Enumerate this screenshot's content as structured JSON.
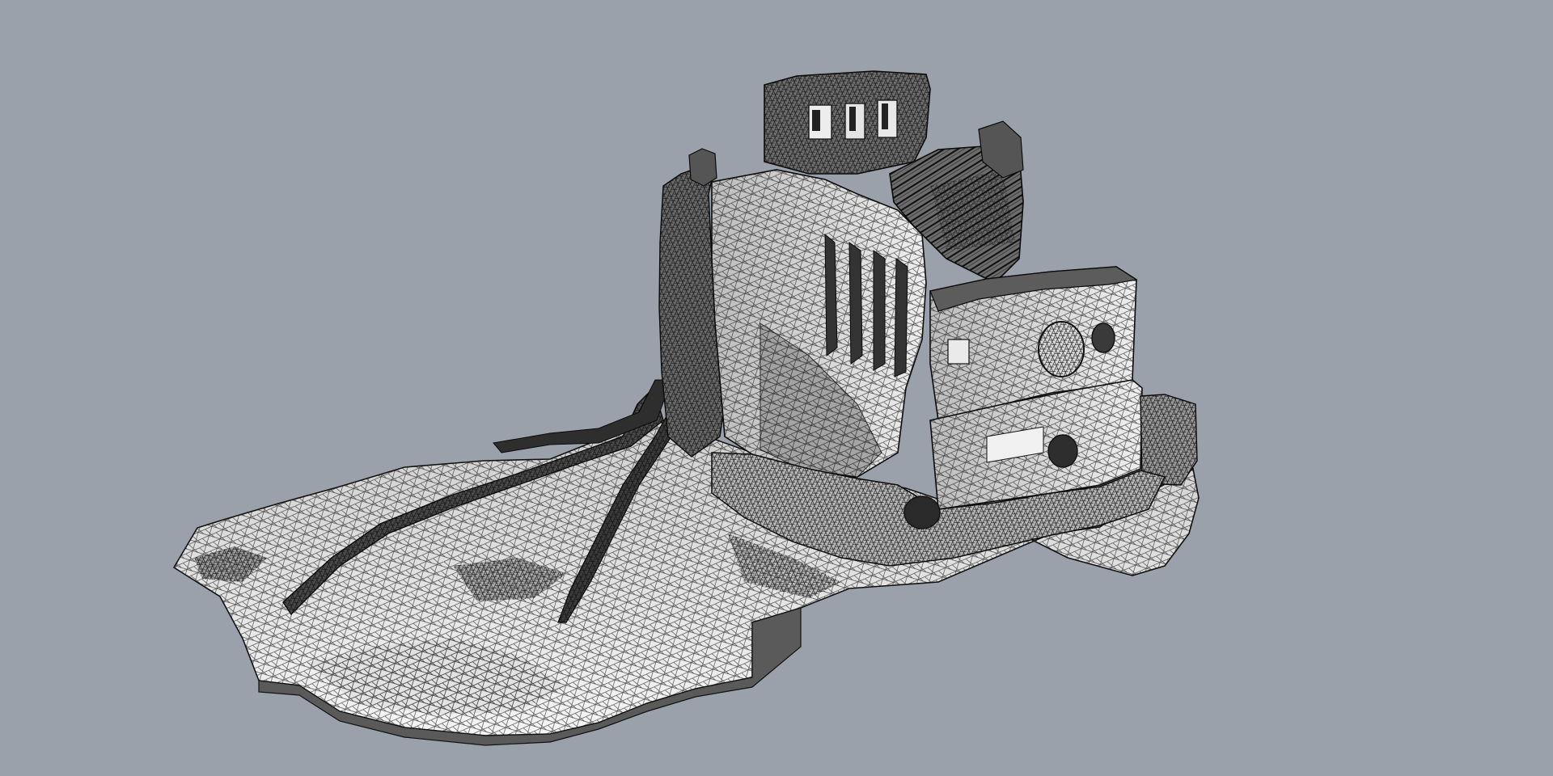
{
  "viewport": {
    "background_color": "#9aa1ab",
    "display_mode": "wireframe-shaded",
    "mesh_fill_light": "#f4f4f4",
    "mesh_fill_dark": "#8a8a8a",
    "wire_color": "#111111"
  },
  "model": {
    "subject": "3d-scanned-mesh"
  }
}
